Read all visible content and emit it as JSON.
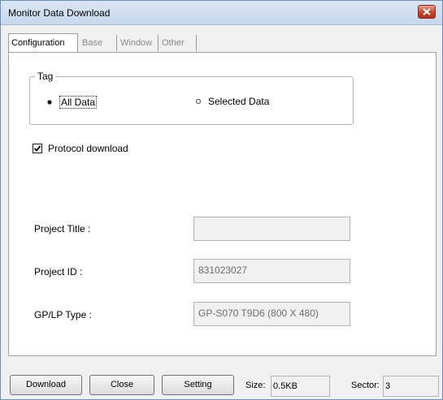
{
  "window": {
    "title": "Monitor Data Download"
  },
  "tabs": [
    {
      "label": "Configuration",
      "active": true
    },
    {
      "label": "Base",
      "active": false
    },
    {
      "label": "Window",
      "active": false
    },
    {
      "label": "Other",
      "active": false
    }
  ],
  "tag_group": {
    "label": "Tag",
    "options": [
      {
        "label": "All Data",
        "selected": true
      },
      {
        "label": "Selected Data",
        "selected": false
      }
    ]
  },
  "protocol_download": {
    "label": "Protocol download",
    "checked": true
  },
  "fields": {
    "project_title": {
      "label": "Project Title :",
      "value": ""
    },
    "project_id": {
      "label": "Project ID  :",
      "value": "831023027"
    },
    "gplp_type": {
      "label": "GP/LP Type :",
      "value": "GP-S070  T9D6  (800 X 480)"
    }
  },
  "buttons": {
    "download": "Download",
    "close": "Close",
    "setting": "Setting"
  },
  "status": {
    "size_label": "Size:",
    "size_value": "0.5KB",
    "sector_label": "Sector:",
    "sector_value": "3"
  }
}
